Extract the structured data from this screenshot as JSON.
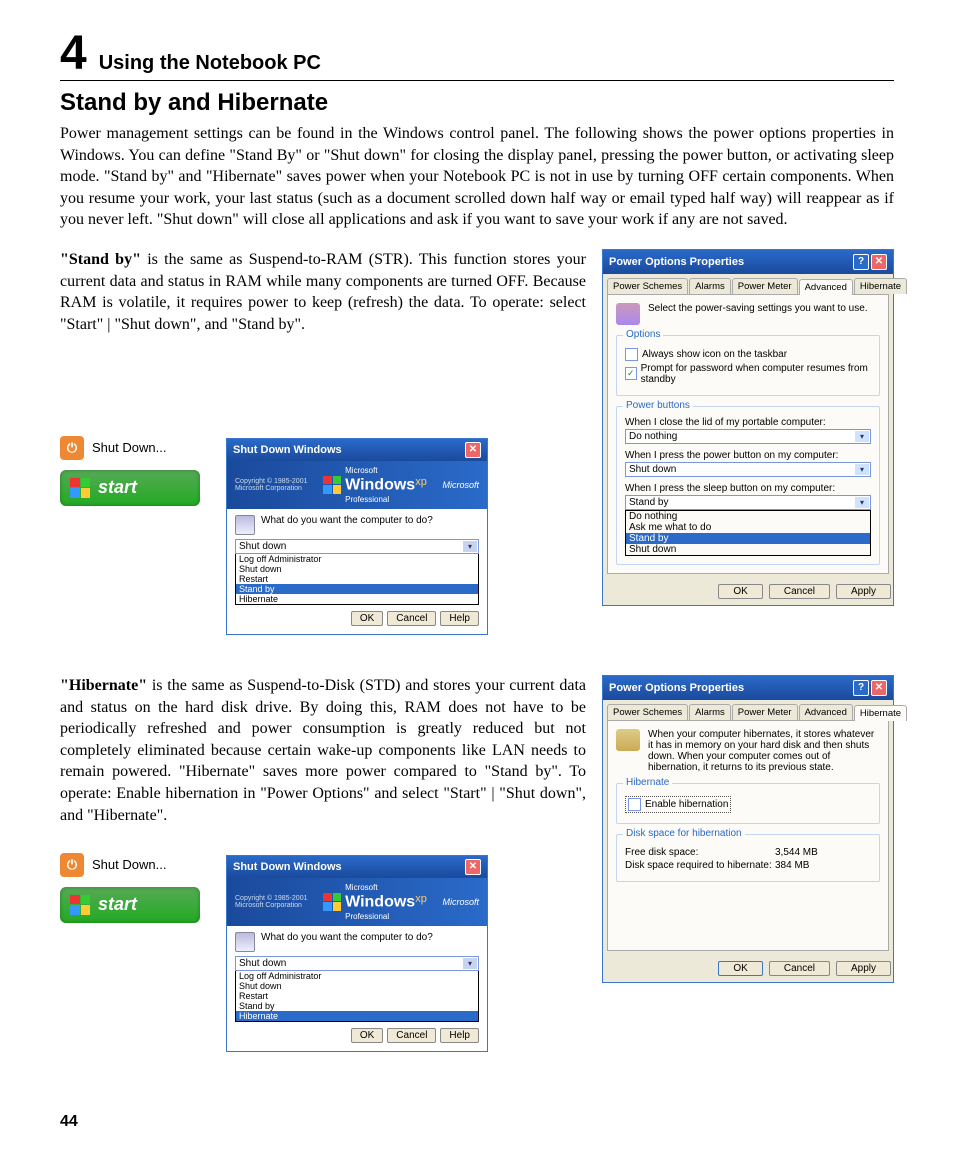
{
  "chapter": {
    "number": "4",
    "title": "Using the Notebook PC"
  },
  "section": {
    "title": "Stand by and Hibernate"
  },
  "intro": "Power management settings can be found in the Windows control panel. The following shows the power options properties in Windows. You can define \"Stand By\" or \"Shut down\" for closing the display panel, pressing the power button, or activating sleep mode. \"Stand by\" and \"Hibernate\" saves power when your Notebook PC is not in use by turning OFF certain components. When you resume your work, your last status (such as a document scrolled down half way or email typed half way) will reappear as if you never left. \"Shut down\" will close all applications and ask if you want to save your work if any are not saved.",
  "standby": {
    "lead": "\"Stand by\"",
    "text": " is the same as Suspend-to-RAM (STR). This function stores your current data and status in RAM while many components are turned OFF. Because RAM is volatile, it requires power to keep (refresh) the data. To operate: select \"Start\" | \"Shut down\", and \"Stand by\"."
  },
  "hibernate": {
    "lead": "\"Hibernate\"",
    "text": " is the same as  Suspend-to-Disk (STD) and stores your current data and status on the hard disk drive. By doing this, RAM does not have to be periodically refreshed and power consumption is greatly reduced but not completely eliminated because certain wake-up components like LAN needs to remain powered. \"Hibernate\" saves more power compared to \"Stand by\". To operate: Enable hibernation in \"Power Options\" and select \"Start\" | \"Shut down\", and \"Hibernate\"."
  },
  "buttons": {
    "shutdown": "Shut Down...",
    "start": "start",
    "powerGlyph": "⏻"
  },
  "shutdownWindow": {
    "title": "Shut Down Windows",
    "brand": "Windows",
    "brandSuffix": "xp",
    "brandSub": "Professional",
    "ms": "Microsoft",
    "copyright": "Copyright © 1985-2001\nMicrosoft Corporation",
    "question": "What do you want the computer to do?",
    "value": "Shut down",
    "options": [
      "Log off Administrator",
      "Shut down",
      "Restart",
      "Stand by",
      "Hibernate"
    ],
    "selectedStandby": "Stand by",
    "selectedHibernate": "Hibernate",
    "btnOk": "OK",
    "btnCancel": "Cancel",
    "btnHelp": "Help"
  },
  "powerOptions": {
    "title": "Power Options Properties",
    "tabs": [
      "Power Schemes",
      "Alarms",
      "Power Meter",
      "Advanced",
      "Hibernate"
    ],
    "advanced": {
      "intro": "Select the power-saving settings you want to use.",
      "optionsLabel": "Options",
      "chkTaskbar": "Always show icon on the taskbar",
      "chkPrompt": "Prompt for password when computer resumes from standby",
      "powerButtonsLabel": "Power buttons",
      "lidLabel": "When I close the lid of my portable computer:",
      "lidValue": "Do nothing",
      "powerLabel": "When I press the power button on my computer:",
      "powerValue": "Shut down",
      "sleepLabel": "When I press the sleep button on my computer:",
      "sleepValue": "Stand by",
      "sleepOptions": [
        "Do nothing",
        "Ask me what to do",
        "Stand by",
        "Shut down"
      ]
    },
    "hibernateTab": {
      "intro": "When your computer hibernates, it stores whatever it has in memory on your hard disk and then shuts down. When your computer comes out of hibernation, it returns to its previous state.",
      "hibernateLabel": "Hibernate",
      "enable": "Enable hibernation",
      "diskLabel": "Disk space for hibernation",
      "freeKey": "Free disk space:",
      "freeVal": "3,544 MB",
      "reqKey": "Disk space required to hibernate:",
      "reqVal": "384 MB"
    },
    "btnOk": "OK",
    "btnCancel": "Cancel",
    "btnApply": "Apply"
  },
  "pageNumber": "44"
}
